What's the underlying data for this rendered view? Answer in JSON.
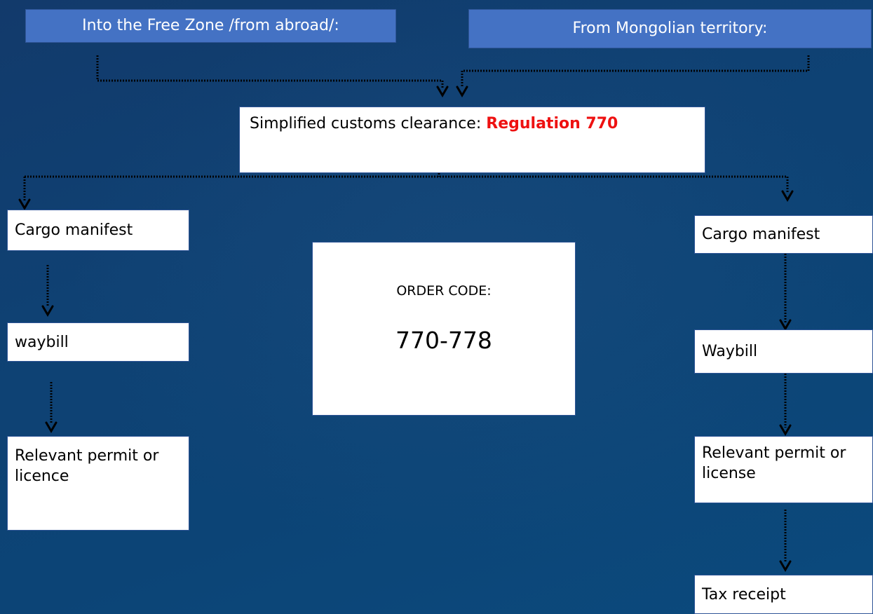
{
  "headers": {
    "left": "Into the Free Zone /from abroad/:",
    "right": "From Mongolian territory:"
  },
  "simplified": {
    "prefix": "Simplified customs clearance: ",
    "regulation": "Regulation 770"
  },
  "left_column": {
    "step1": "Cargo manifest",
    "step2": "waybill",
    "step3": "Relevant permit or licence"
  },
  "right_column": {
    "step1": "Cargo manifest",
    "step2": "Waybill",
    "step3": "Relevant permit or license",
    "step4": "Tax receipt"
  },
  "order": {
    "label": "ORDER CODE:",
    "code": "770-778"
  },
  "colors": {
    "header_fill": "#4472c4",
    "background": "#0f4173",
    "regulation_red": "#ee1111",
    "connector": "#000000"
  }
}
